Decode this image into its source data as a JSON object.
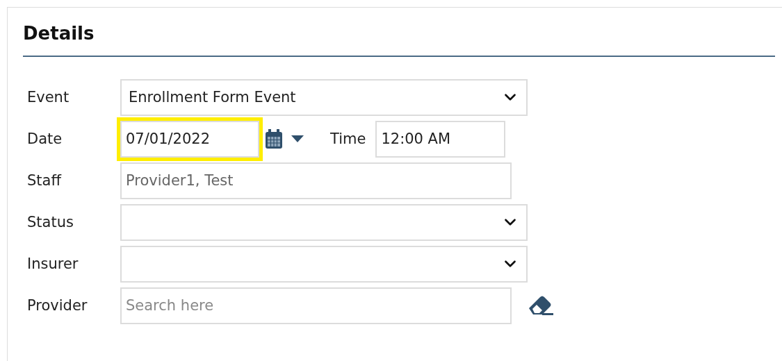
{
  "panel": {
    "title": "Details"
  },
  "fields": [
    {
      "kind": "select",
      "label": "Event",
      "value": "Enrollment Form Event"
    },
    {
      "kind": "date",
      "label": "Date",
      "value": "07/01/2022",
      "highlighted": true,
      "time_label": "Time",
      "time_value": "12:00 AM"
    },
    {
      "kind": "text",
      "label": "Staff",
      "value": "Provider1, Test",
      "disabled": true
    },
    {
      "kind": "select",
      "label": "Status"
    },
    {
      "kind": "select",
      "label": "Insurer"
    },
    {
      "kind": "search",
      "label": "Provider",
      "placeholder": "Search here"
    }
  ]
}
